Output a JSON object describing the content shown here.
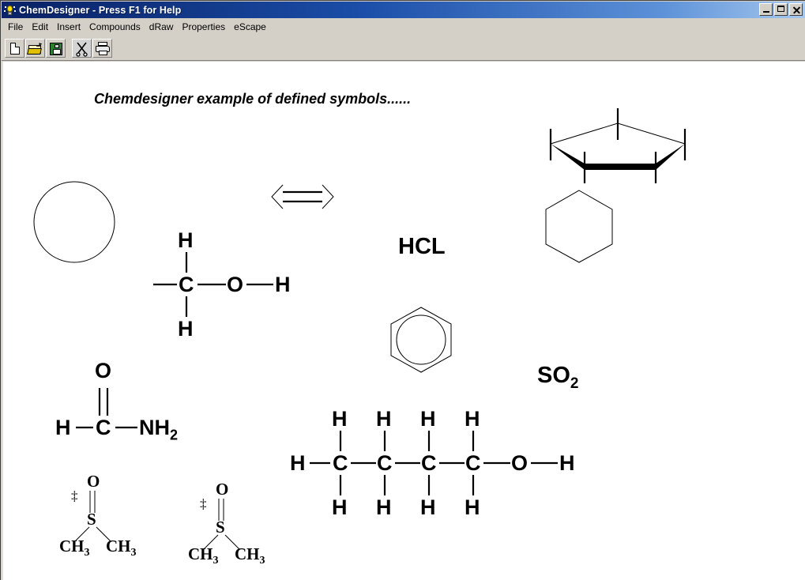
{
  "window": {
    "title": "ChemDesigner - Press F1 for Help",
    "app_icon": "lightbulb-icon",
    "controls": {
      "minimize": "minimize-button",
      "maximize": "maximize-button",
      "close": "close-button"
    },
    "titlebar_color": "#0a246a",
    "chrome_color": "#d4d0c8",
    "canvas_color": "#ffffff"
  },
  "menu": {
    "items": [
      {
        "label": "File"
      },
      {
        "label": "Edit"
      },
      {
        "label": "Insert"
      },
      {
        "label": "Compounds"
      },
      {
        "label": "dRaw"
      },
      {
        "label": "Properties"
      },
      {
        "label": "eScape"
      }
    ]
  },
  "toolbar": {
    "buttons": [
      {
        "name": "new-document-button",
        "icon": "new-document-icon",
        "enabled": true
      },
      {
        "name": "open-file-button",
        "icon": "open-folder-icon",
        "enabled": true
      },
      {
        "name": "save-button",
        "icon": "floppy-disk-icon",
        "enabled": true
      },
      {
        "name": "cut-button",
        "icon": "scissors-icon",
        "enabled": false
      },
      {
        "name": "print-button",
        "icon": "printer-icon",
        "enabled": true
      }
    ]
  },
  "canvas": {
    "heading": "Chemdesigner example of defined symbols......",
    "shapes": [
      {
        "name": "circle-shape",
        "kind": "circle"
      },
      {
        "name": "resonance-arrow",
        "kind": "double-headed-arrow"
      },
      {
        "name": "pentagon-haworth-ring",
        "kind": "pentagon-3d-wedge"
      },
      {
        "name": "cyclohexane-ring",
        "kind": "hexagon"
      },
      {
        "name": "benzene-ring",
        "kind": "hexagon-with-circle"
      }
    ],
    "formulas": [
      {
        "name": "formula-hcl",
        "text": "HCL"
      },
      {
        "name": "formula-so2",
        "base": "SO",
        "sub": "2"
      }
    ],
    "structures": [
      {
        "name": "methanol-structure",
        "atoms": [
          "H",
          "C",
          "O",
          "H",
          "H"
        ],
        "labels": {
          "top_h": "H",
          "center_c": "C",
          "oxygen": "O",
          "right_h": "H",
          "bottom_h": "H"
        }
      },
      {
        "name": "formamide-structure",
        "labels": {
          "oxygen": "O",
          "left_h": "H",
          "carbon": "C",
          "amine_base": "NH",
          "amine_sub": "2"
        }
      },
      {
        "name": "butanol-structure",
        "left_h": "H",
        "carbons": [
          "C",
          "C",
          "C",
          "C"
        ],
        "top_hydrogens": [
          "H",
          "H",
          "H",
          "H"
        ],
        "bottom_hydrogens": [
          "H",
          "H",
          "H",
          "H"
        ],
        "oxygen": "O",
        "right_h": "H"
      },
      {
        "name": "dmso-structure-1",
        "labels": {
          "oxygen": "O",
          "sulfur": "S",
          "methyl_left_base": "CH",
          "methyl_left_sub": "3",
          "methyl_right_base": "CH",
          "methyl_right_sub": "3",
          "charge_mark": "‡"
        }
      },
      {
        "name": "dmso-structure-2",
        "labels": {
          "oxygen": "O",
          "sulfur": "S",
          "methyl_left_base": "CH",
          "methyl_left_sub": "3",
          "methyl_right_base": "CH",
          "methyl_right_sub": "3",
          "charge_mark": "‡"
        }
      }
    ]
  }
}
